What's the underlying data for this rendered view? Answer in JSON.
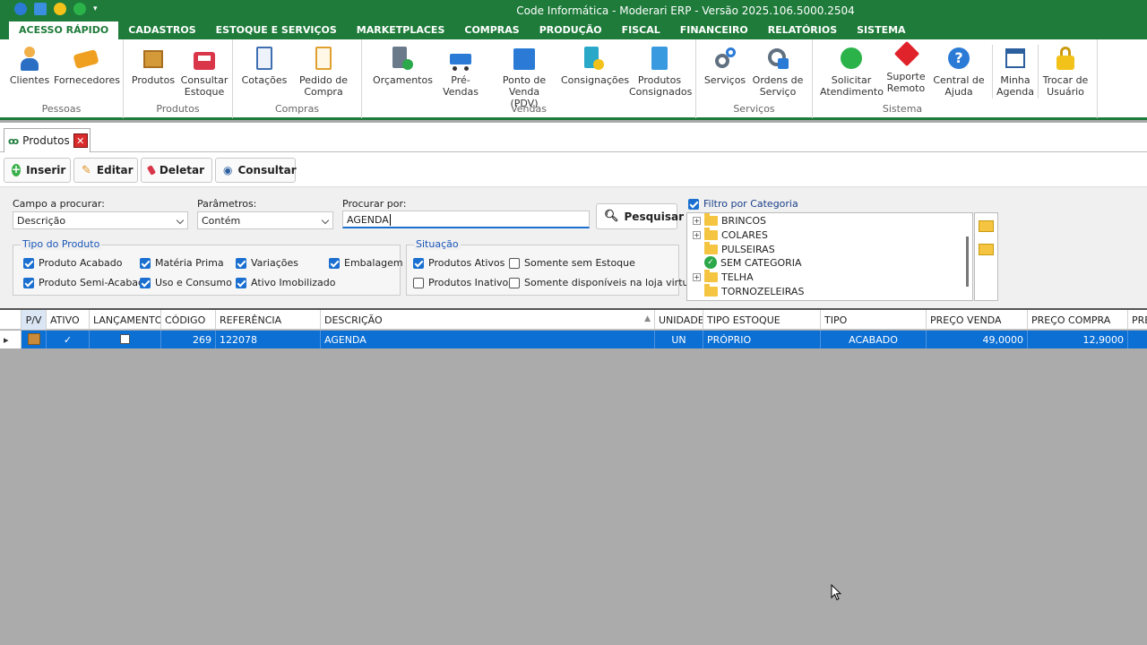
{
  "window": {
    "title": "Code Informática - Moderari ERP - Versão 2025.106.5000.2504"
  },
  "menu": [
    {
      "label": "ACESSO RÁPIDO",
      "active": true
    },
    {
      "label": "CADASTROS"
    },
    {
      "label": "ESTOQUE E SERVIÇOS"
    },
    {
      "label": "MARKETPLACES"
    },
    {
      "label": "COMPRAS"
    },
    {
      "label": "PRODUÇÃO"
    },
    {
      "label": "FISCAL"
    },
    {
      "label": "FINANCEIRO"
    },
    {
      "label": "RELATÓRIOS"
    },
    {
      "label": "SISTEMA"
    }
  ],
  "ribbon": {
    "groups": {
      "pessoas": "Pessoas",
      "produtos": "Produtos",
      "compras": "Compras",
      "vendas": "Vendas",
      "servicos": "Serviços",
      "sistema": "Sistema"
    },
    "buttons": {
      "clientes": "Clientes",
      "fornecedores": "Fornecedores",
      "produtos": "Produtos",
      "consultar_estoque_1": "Consultar",
      "consultar_estoque_2": "Estoque",
      "cotacoes": "Cotações",
      "pedido_1": "Pedido de",
      "pedido_2": "Compra",
      "orcamentos": "Orçamentos",
      "prevendas": "Pré-Vendas",
      "pdv_1": "Ponto de",
      "pdv_2": "Venda (PDV)",
      "consignacoes": "Consignações",
      "consignados_1": "Produtos",
      "consignados_2": "Consignados",
      "servicos": "Serviços",
      "ordens_1": "Ordens de",
      "ordens_2": "Serviço",
      "atendimento_1": "Solicitar",
      "atendimento_2": "Atendimento",
      "suporte_1": "Suporte",
      "suporte_2": "Remoto",
      "ajuda_1": "Central de",
      "ajuda_2": "Ajuda",
      "agenda_1": "Minha",
      "agenda_2": "Agenda",
      "trocar_1": "Trocar de",
      "trocar_2": "Usuário"
    }
  },
  "tab": {
    "label": "Produtos"
  },
  "toolbar": {
    "inserir": "Inserir",
    "editar": "Editar",
    "deletar": "Deletar",
    "consultar": "Consultar"
  },
  "filters": {
    "campo_label": "Campo a procurar:",
    "campo_value": "Descrição",
    "param_label": "Parâmetros:",
    "param_value": "Contém",
    "procurar_label": "Procurar por:",
    "procurar_value": "AGENDA",
    "pesquisar": "Pesquisar",
    "tipo_title": "Tipo do Produto",
    "tipo": {
      "acabado": "Produto Acabado",
      "materia": "Matéria Prima",
      "variacoes": "Variações",
      "embalagem": "Embalagem",
      "semi": "Produto Semi-Acabado",
      "uso": "Uso e Consumo",
      "imobilizado": "Ativo Imobilizado"
    },
    "situacao_title": "Situação",
    "situacao": {
      "ativos": "Produtos Ativos",
      "sem_estoque": "Somente sem Estoque",
      "inativos": "Produtos Inativos",
      "loja": "Somente disponíveis na loja virtual"
    },
    "categoria_label": "Filtro por Categoria",
    "categorias": [
      "BRINCOS",
      "COLARES",
      "PULSEIRAS",
      "SEM CATEGORIA",
      "TELHA",
      "TORNOZELEIRAS"
    ]
  },
  "grid": {
    "headers": [
      "P/V",
      "ATIVO",
      "LANÇAMENTO",
      "CÓDIGO",
      "REFERÊNCIA",
      "DESCRIÇÃO",
      "UNIDADE",
      "TIPO ESTOQUE",
      "TIPO",
      "PREÇO VENDA",
      "PREÇO COMPRA",
      "PRE"
    ],
    "row": {
      "codigo": "269",
      "referencia": "122078",
      "descricao": "AGENDA",
      "unidade": "UN",
      "tipo_estoque": "PRÓPRIO",
      "tipo": "ACABADO",
      "preco_venda": "49,0000",
      "preco_compra": "12,9000"
    }
  },
  "colors": {
    "brand": "#1e7b3a",
    "selection": "#0b6fd4"
  }
}
